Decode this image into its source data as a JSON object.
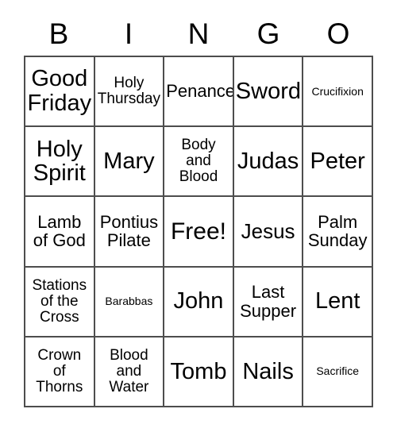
{
  "header": {
    "letters": [
      "B",
      "I",
      "N",
      "G",
      "O"
    ]
  },
  "grid": {
    "rows": [
      [
        {
          "text": "Good\nFriday",
          "size": "s-xxl"
        },
        {
          "text": "Holy\nThursday",
          "size": "s-md"
        },
        {
          "text": "Penance",
          "size": "s-lg"
        },
        {
          "text": "Sword",
          "size": "s-xxl"
        },
        {
          "text": "Crucifixion",
          "size": "s-xs"
        }
      ],
      [
        {
          "text": "Holy\nSpirit",
          "size": "s-xxl"
        },
        {
          "text": "Mary",
          "size": "s-xxl"
        },
        {
          "text": "Body\nand\nBlood",
          "size": "s-md"
        },
        {
          "text": "Judas",
          "size": "s-xxl"
        },
        {
          "text": "Peter",
          "size": "s-xxl"
        }
      ],
      [
        {
          "text": "Lamb\nof God",
          "size": "s-lg"
        },
        {
          "text": "Pontius\nPilate",
          "size": "s-lg"
        },
        {
          "text": "Free!",
          "size": "s-free"
        },
        {
          "text": "Jesus",
          "size": "s-xl"
        },
        {
          "text": "Palm\nSunday",
          "size": "s-lg"
        }
      ],
      [
        {
          "text": "Stations\nof the\nCross",
          "size": "s-md"
        },
        {
          "text": "Barabbas",
          "size": "s-xs"
        },
        {
          "text": "John",
          "size": "s-xxl"
        },
        {
          "text": "Last\nSupper",
          "size": "s-lg"
        },
        {
          "text": "Lent",
          "size": "s-xxl"
        }
      ],
      [
        {
          "text": "Crown\nof\nThorns",
          "size": "s-md"
        },
        {
          "text": "Blood\nand\nWater",
          "size": "s-md"
        },
        {
          "text": "Tomb",
          "size": "s-xxl"
        },
        {
          "text": "Nails",
          "size": "s-xxl"
        },
        {
          "text": "Sacrifice",
          "size": "s-xs"
        }
      ]
    ]
  },
  "colors": {
    "background": "#ffffff",
    "border": "#4d4d4d",
    "text": "#000000"
  }
}
